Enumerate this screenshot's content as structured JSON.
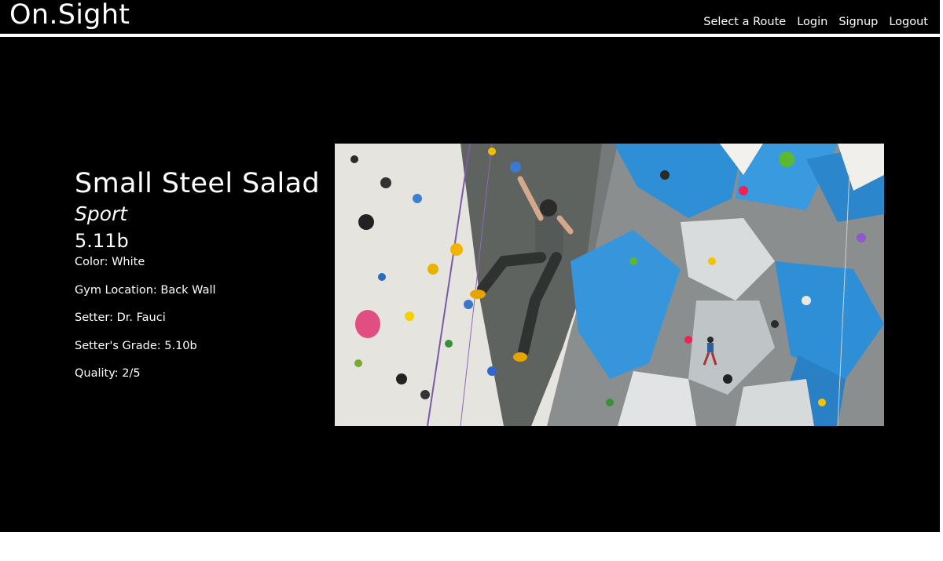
{
  "app": {
    "brand": "On.Sight"
  },
  "nav": {
    "items": [
      {
        "label": "Select a Route"
      },
      {
        "label": "Login"
      },
      {
        "label": "Signup"
      },
      {
        "label": "Logout"
      }
    ]
  },
  "route": {
    "name": "Small Steel Salad",
    "type": "Sport",
    "grade": "5.11b",
    "details": {
      "color": "Color: White",
      "location": "Gym Location: Back Wall",
      "setter": "Setter: Dr. Fauci",
      "setter_grade": "Setter's Grade: 5.10b",
      "quality": "Quality: 2/5"
    }
  },
  "theme": {
    "background": "#000000",
    "text": "#ffffff",
    "wall_blue": "#2f8fd6",
    "wall_grey": "#5f6360",
    "wall_white": "#e6e4df"
  }
}
